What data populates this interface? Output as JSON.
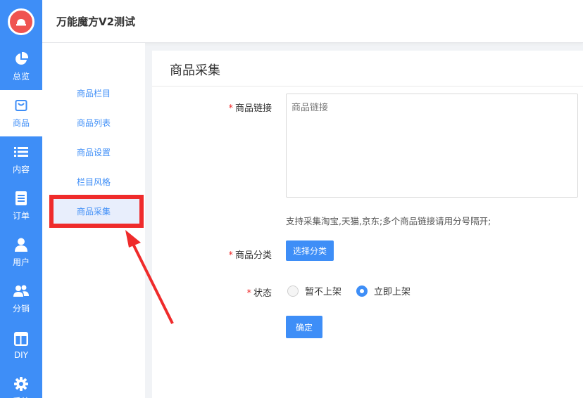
{
  "header": {
    "title": "万能魔方V2测试"
  },
  "rail": {
    "items": [
      {
        "label": "总览",
        "icon": "pie-chart-icon"
      },
      {
        "label": "商品",
        "icon": "bag-icon"
      },
      {
        "label": "内容",
        "icon": "list-icon"
      },
      {
        "label": "订单",
        "icon": "document-icon"
      },
      {
        "label": "用户",
        "icon": "user-icon"
      },
      {
        "label": "分销",
        "icon": "users-icon"
      },
      {
        "label": "DIY",
        "icon": "layout-icon"
      },
      {
        "label": "系统",
        "icon": "gear-icon"
      }
    ]
  },
  "submenu": {
    "items": [
      {
        "label": "商品栏目"
      },
      {
        "label": "商品列表"
      },
      {
        "label": "商品设置"
      },
      {
        "label": "栏目风格"
      },
      {
        "label": "商品采集"
      }
    ]
  },
  "panel": {
    "title": "商品采集",
    "link_label": "商品链接",
    "link_placeholder": "商品链接",
    "hint": "支持采集淘宝,天猫,京东;多个商品链接请用分号隔开;",
    "category_label": "商品分类",
    "category_button": "选择分类",
    "status_label": "状态",
    "status_options": [
      {
        "label": "暂不上架",
        "checked": false
      },
      {
        "label": "立即上架",
        "checked": true
      }
    ],
    "confirm_button": "确定"
  },
  "colors": {
    "primary": "#3e8ef7",
    "required": "#ef2b2b",
    "annotation": "#ef2b2b"
  }
}
